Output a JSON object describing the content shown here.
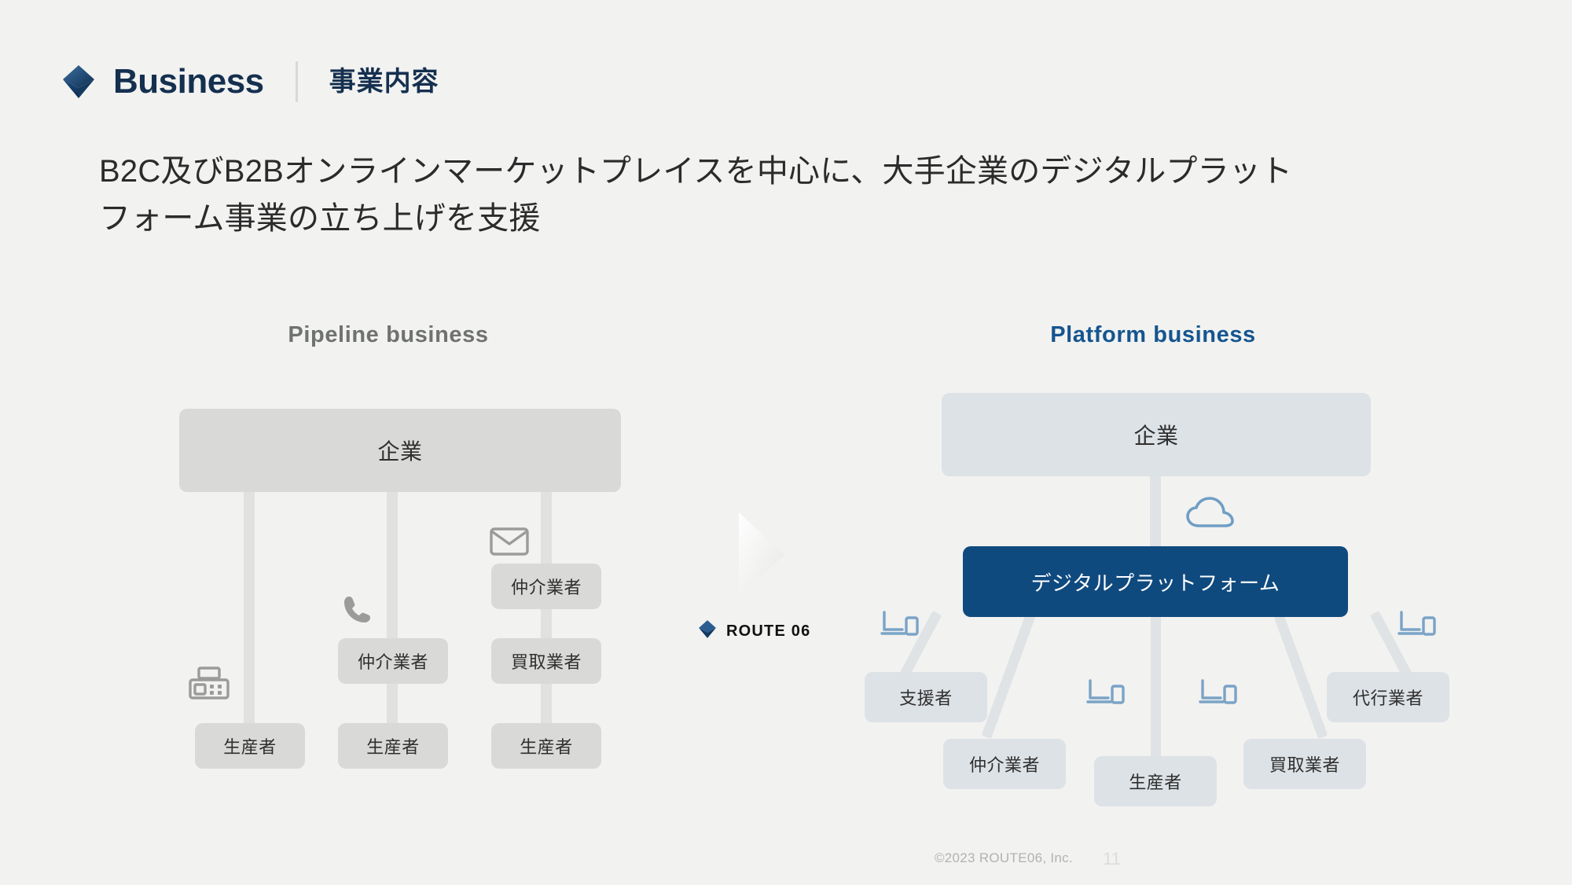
{
  "header": {
    "logo_icon": "diamond-logo-icon",
    "brand": "Business",
    "jp_title": "事業内容",
    "accent_color": "#15304f"
  },
  "subtitle": {
    "line1": "B2C及びB2Bオンラインマーケットプレイスを中心に、大手企業のデジタルプラット",
    "line2": "フォーム事業の立ち上げを支援"
  },
  "pipeline": {
    "heading": "Pipeline business",
    "heading_color": "#6f7270",
    "top_node": "企業",
    "columns": [
      {
        "icon": "fax-icon",
        "nodes": [
          "生産者"
        ]
      },
      {
        "icon": "phone-icon",
        "nodes": [
          "仲介業者",
          "生産者"
        ]
      },
      {
        "icon": "mail-icon",
        "nodes": [
          "仲介業者",
          "買取業者",
          "生産者"
        ]
      }
    ]
  },
  "transition": {
    "arrow_icon": "play-triangle-icon",
    "logo_icon": "diamond-logo-icon",
    "label": "ROUTE 06"
  },
  "platform": {
    "heading": "Platform business",
    "heading_color": "#15558f",
    "top_node": "企業",
    "cloud_icon": "cloud-icon",
    "center_node": "デジタルプラットフォーム",
    "center_node_color": "#0f4a7f",
    "leaves": [
      {
        "label": "支援者",
        "icon": "devices-icon"
      },
      {
        "label": "仲介業者",
        "icon": null
      },
      {
        "label": "生産者",
        "icon": "devices-icon"
      },
      {
        "label": "買取業者",
        "icon": "devices-icon"
      },
      {
        "label": "代行業者",
        "icon": "devices-icon"
      }
    ]
  },
  "footer": {
    "copyright": "©2023 ROUTE06, Inc.",
    "page_number": "11"
  }
}
